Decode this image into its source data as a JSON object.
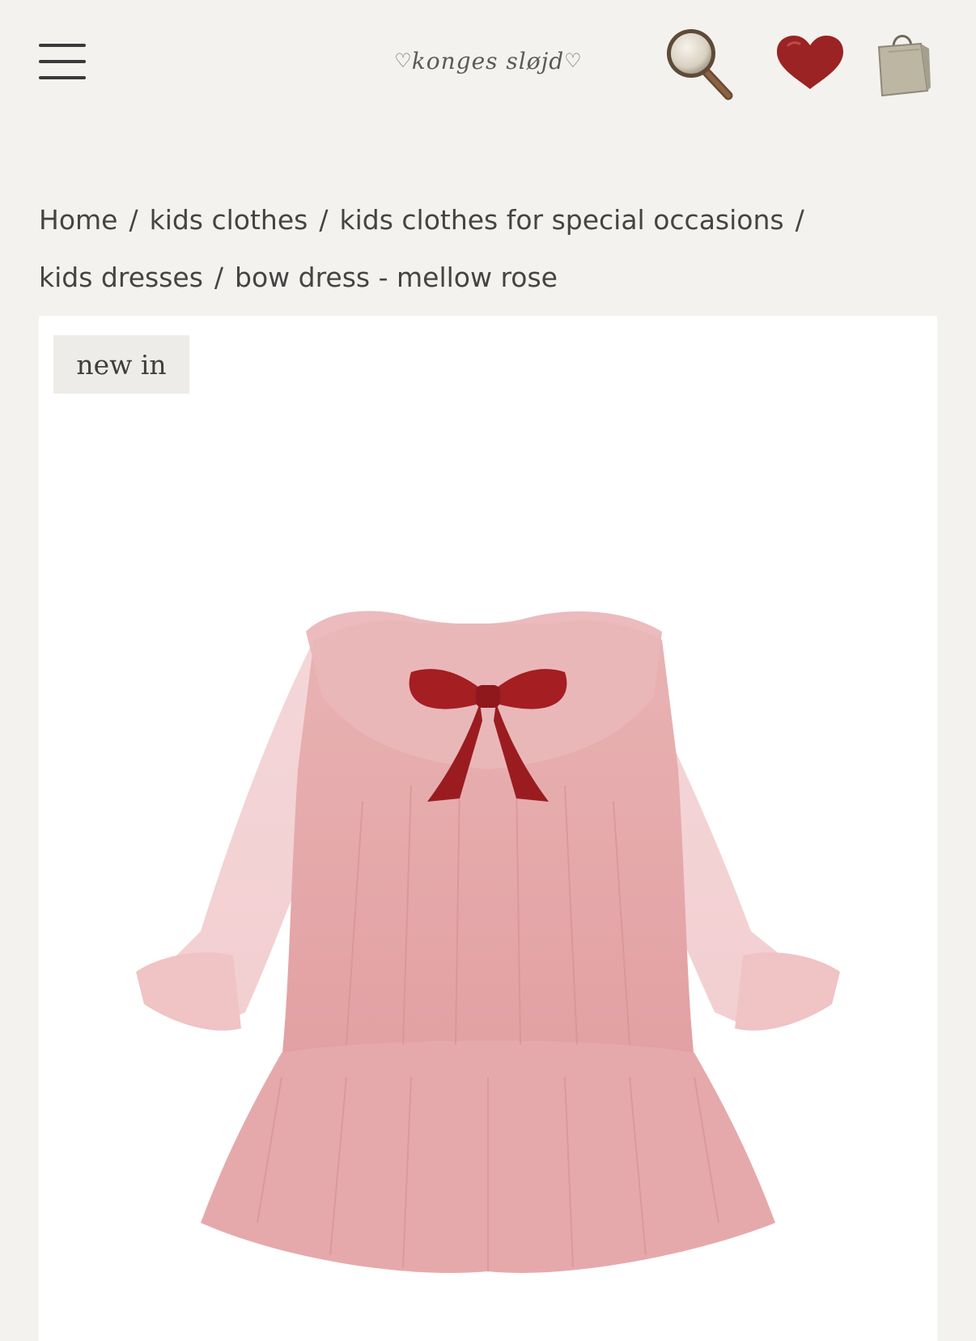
{
  "header": {
    "menu_icon": "hamburger-icon",
    "logo_text": "konges sløjd",
    "search_icon": "magnifying-glass-icon",
    "wishlist_icon": "heart-icon",
    "bag_icon": "shopping-bag-icon",
    "colors": {
      "heart": "#9b2323",
      "bag": "#b7b09c",
      "background": "#f4f2ee"
    }
  },
  "breadcrumb": {
    "items": [
      {
        "label": "Home"
      },
      {
        "label": "kids clothes"
      },
      {
        "label": "kids clothes for special occasions"
      },
      {
        "label": "kids dresses"
      },
      {
        "label": "bow dress - mellow rose"
      }
    ],
    "separator": "/"
  },
  "product": {
    "badge": "new in",
    "image_subject": "pink tulle dress with red velvet bow",
    "colors": {
      "dress": "#e8a9a9",
      "bow": "#a41e22"
    }
  }
}
